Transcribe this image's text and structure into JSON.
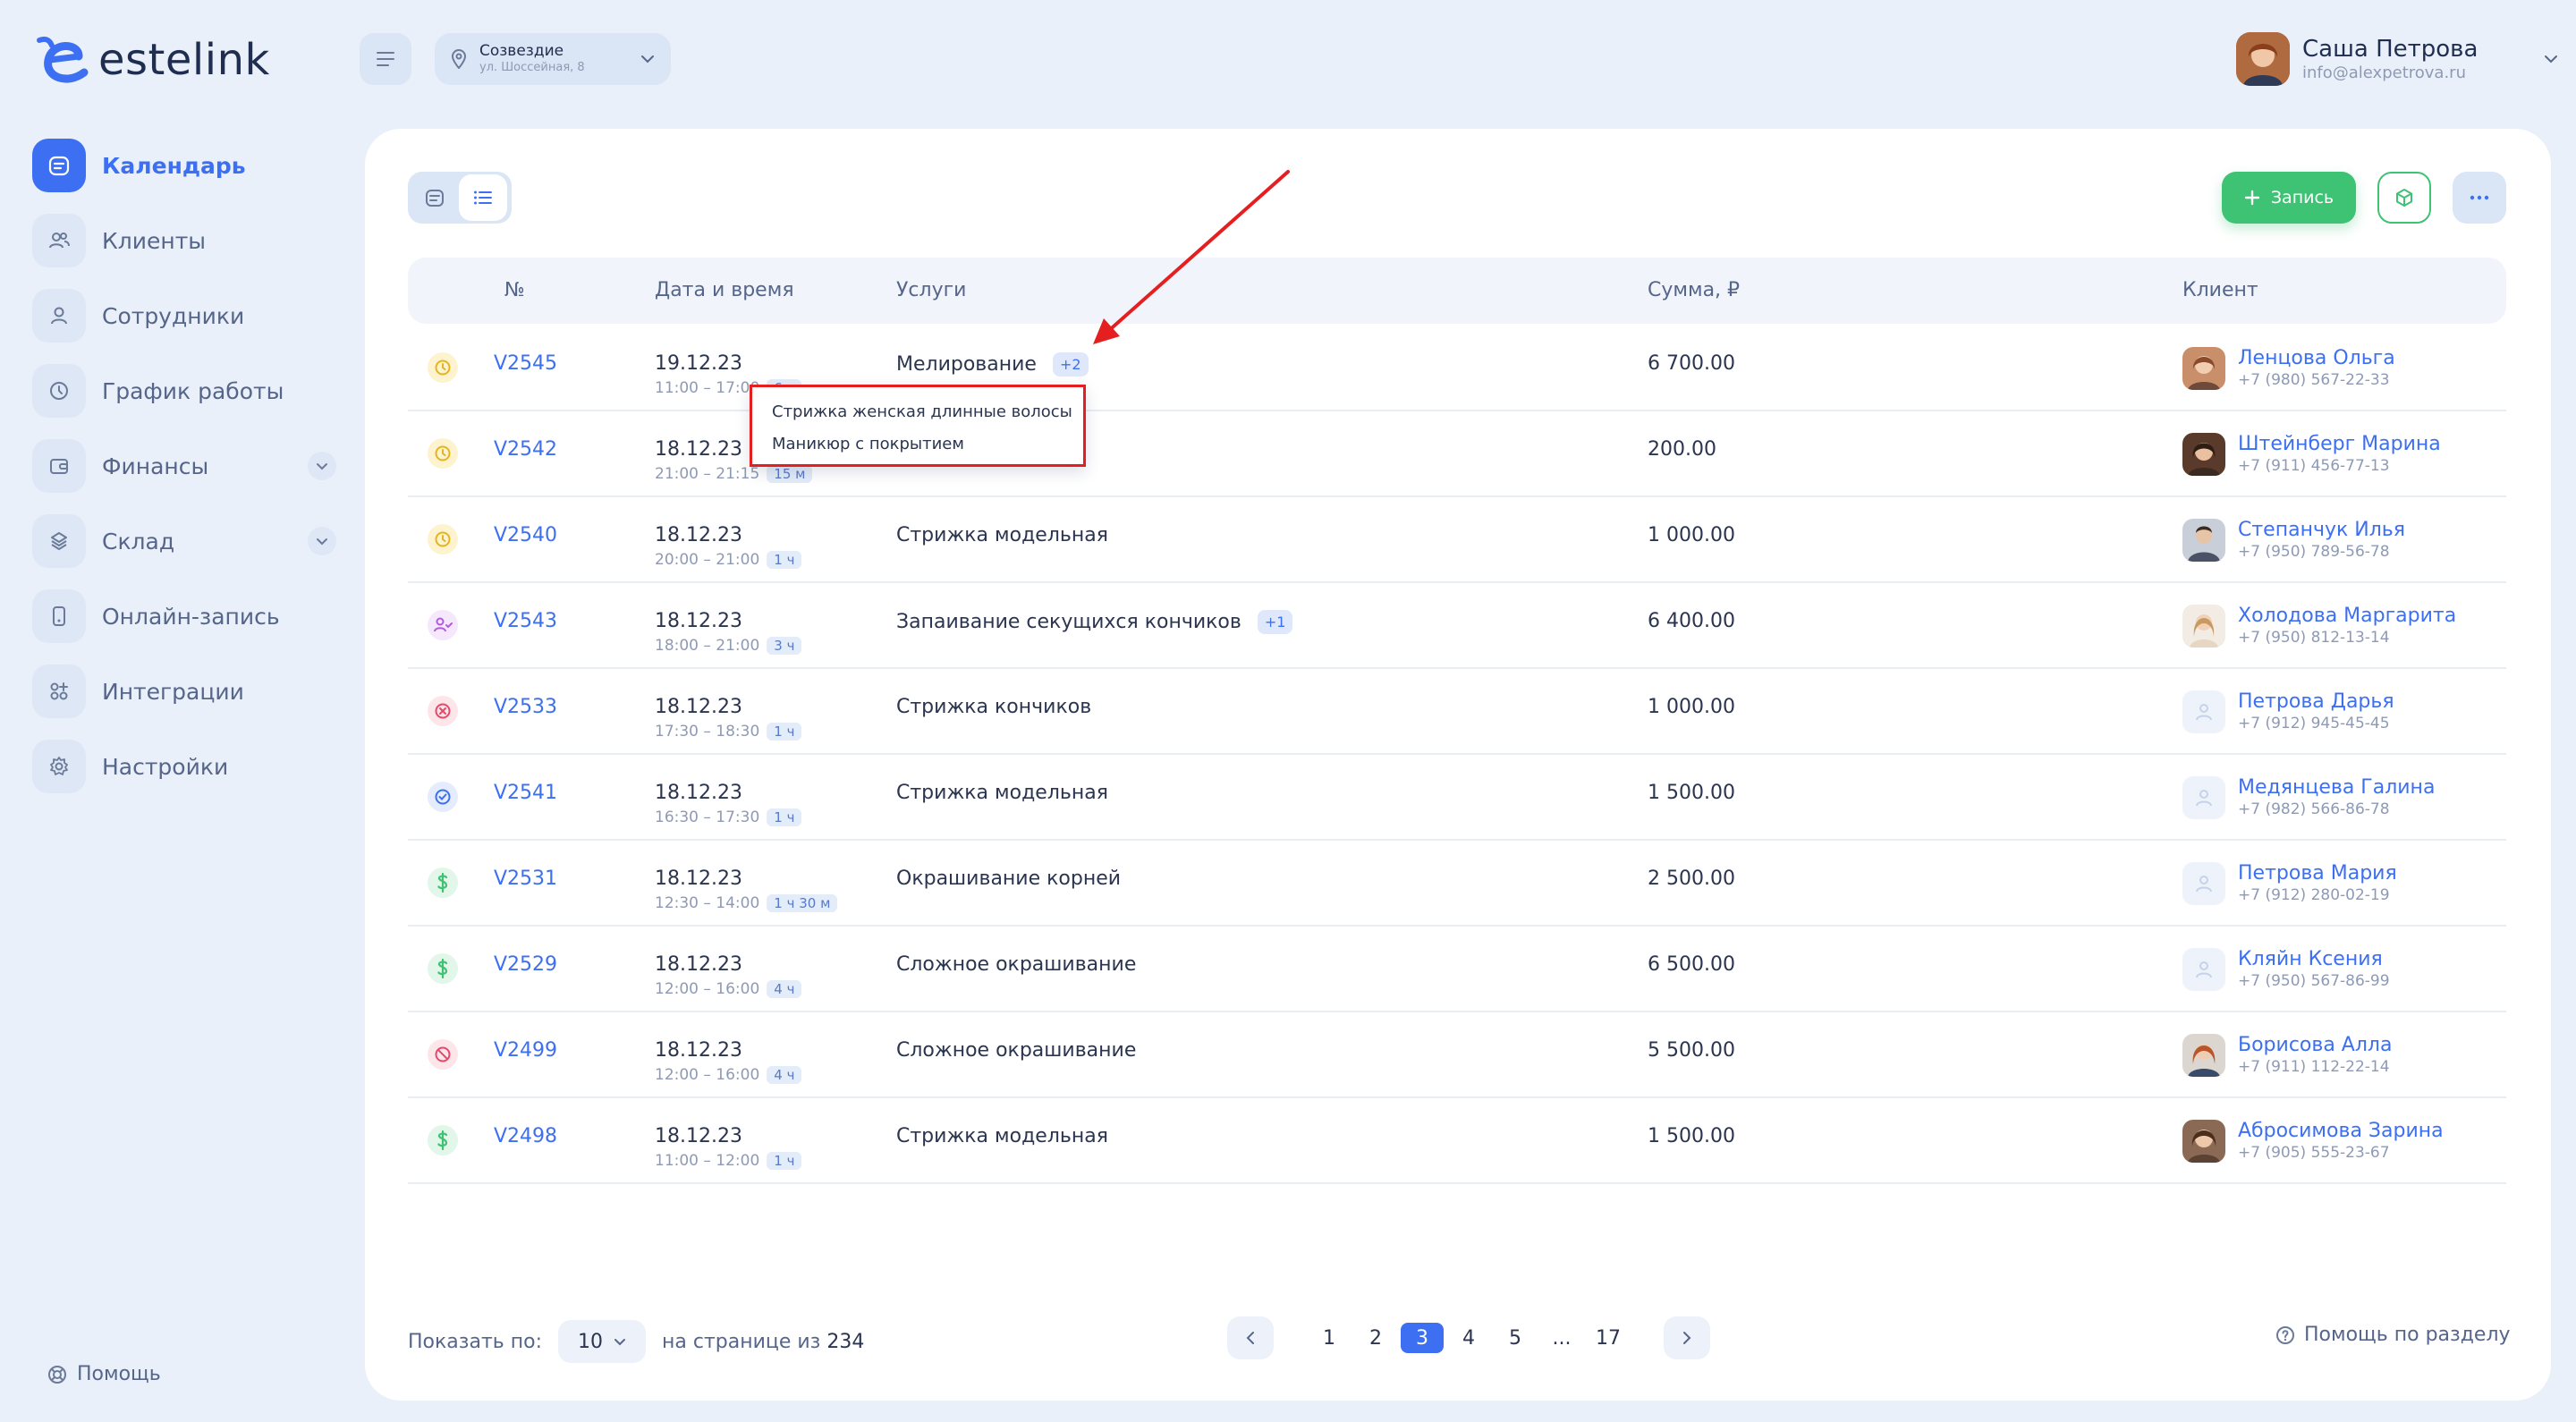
{
  "logo": {
    "text": "estelink"
  },
  "location": {
    "name": "Созвездие",
    "address": "ул. Шоссейная, 8"
  },
  "user": {
    "name": "Саша Петрова",
    "email": "info@alexpetrova.ru"
  },
  "nav": [
    {
      "label": "Календарь",
      "icon": "calendar-icon",
      "active": true
    },
    {
      "label": "Клиенты",
      "icon": "clients-icon"
    },
    {
      "label": "Сотрудники",
      "icon": "person-icon"
    },
    {
      "label": "График работы",
      "icon": "clock-icon"
    },
    {
      "label": "Финансы",
      "icon": "wallet-icon",
      "expandable": true
    },
    {
      "label": "Склад",
      "icon": "warehouse-icon",
      "expandable": true
    },
    {
      "label": "Онлайн-запись",
      "icon": "phone-icon"
    },
    {
      "label": "Интеграции",
      "icon": "integrations-icon"
    },
    {
      "label": "Настройки",
      "icon": "gear-icon"
    }
  ],
  "help": "Помощь",
  "toolbar": {
    "add_label": "Запись"
  },
  "table": {
    "headers": {
      "num": "№",
      "date": "Дата и время",
      "services": "Услуги",
      "sum": "Сумма, ₽",
      "client": "Клиент"
    },
    "rows": [
      {
        "status": "pending",
        "num": "V2545",
        "date": "19.12.23",
        "time": "11:00 – 17:00",
        "dur": "6 ч",
        "service": "Мелирование",
        "more": "+2",
        "sum": "6 700.00",
        "client": "Ленцова Ольга",
        "phone": "+7 (980) 567-22-33",
        "avatar": "photo"
      },
      {
        "status": "pending",
        "num": "V2542",
        "date": "18.12.23",
        "time": "21:00 – 21:15",
        "dur": "15 м",
        "service": "",
        "more": "",
        "sum": "200.00",
        "client": "Штейнберг Марина",
        "phone": "+7 (911) 456-77-13",
        "avatar": "photo"
      },
      {
        "status": "pending",
        "num": "V2540",
        "date": "18.12.23",
        "time": "20:00 – 21:00",
        "dur": "1 ч",
        "service": "Стрижка модельная",
        "more": "",
        "sum": "1 000.00",
        "client": "Степанчук Илья",
        "phone": "+7 (950) 789-56-78",
        "avatar": "photo"
      },
      {
        "status": "arrived",
        "num": "V2543",
        "date": "18.12.23",
        "time": "18:00 – 21:00",
        "dur": "3 ч",
        "service": "Запаивание секущихся кончиков",
        "more": "+1",
        "sum": "6 400.00",
        "client": "Холодова Маргарита",
        "phone": "+7 (950) 812-13-14",
        "avatar": "photo"
      },
      {
        "status": "cancelled",
        "num": "V2533",
        "date": "18.12.23",
        "time": "17:30 – 18:30",
        "dur": "1 ч",
        "service": "Стрижка кончиков",
        "more": "",
        "sum": "1 000.00",
        "client": "Петрова Дарья",
        "phone": "+7 (912) 945-45-45",
        "avatar": "placeholder"
      },
      {
        "status": "confirmed",
        "num": "V2541",
        "date": "18.12.23",
        "time": "16:30 – 17:30",
        "dur": "1 ч",
        "service": "Стрижка модельная",
        "more": "",
        "sum": "1 500.00",
        "client": "Медянцева Галина",
        "phone": "+7 (982) 566-86-78",
        "avatar": "placeholder"
      },
      {
        "status": "paid",
        "num": "V2531",
        "date": "18.12.23",
        "time": "12:30 – 14:00",
        "dur": "1 ч 30 м",
        "service": "Окрашивание корней",
        "more": "",
        "sum": "2 500.00",
        "client": "Петрова Мария",
        "phone": "+7 (912) 280-02-19",
        "avatar": "placeholder"
      },
      {
        "status": "paid",
        "num": "V2529",
        "date": "18.12.23",
        "time": "12:00 – 16:00",
        "dur": "4 ч",
        "service": "Сложное окрашивание",
        "more": "",
        "sum": "6 500.00",
        "client": "Кляйн Ксения",
        "phone": "+7 (950) 567-86-99",
        "avatar": "placeholder"
      },
      {
        "status": "noshow",
        "num": "V2499",
        "date": "18.12.23",
        "time": "12:00 – 16:00",
        "dur": "4 ч",
        "service": "Сложное окрашивание",
        "more": "",
        "sum": "5 500.00",
        "client": "Борисова Алла",
        "phone": "+7 (911) 112-22-14",
        "avatar": "photo"
      },
      {
        "status": "paid",
        "num": "V2498",
        "date": "18.12.23",
        "time": "11:00 – 12:00",
        "dur": "1 ч",
        "service": "Стрижка модельная",
        "more": "",
        "sum": "1 500.00",
        "client": "Абросимова Зарина",
        "phone": "+7 (905) 555-23-67",
        "avatar": "photo"
      }
    ]
  },
  "popup": {
    "items": [
      "Стрижка женская длинные волосы",
      "Маникюр с покрытием"
    ]
  },
  "footer": {
    "show_label": "Показать по:",
    "per_page": "10",
    "of_label": "на странице из",
    "total": "234",
    "pages": [
      "1",
      "2",
      "3",
      "4",
      "5",
      "...",
      "17"
    ],
    "active_page": "3",
    "help_section": "Помощь по разделу"
  },
  "colors": {
    "accent": "#3d6ff2",
    "success": "#3ec274",
    "warning": "#f2c230",
    "danger": "#e5486a",
    "arrived": "#b45ae0",
    "annotation": "#e51f1f"
  }
}
